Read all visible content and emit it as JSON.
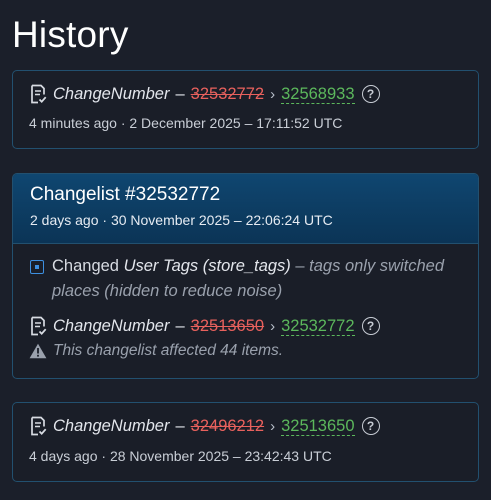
{
  "page": {
    "title": "History"
  },
  "entries": [
    {
      "label": "ChangeNumber",
      "dash": "–",
      "old_value": "32532772",
      "arrow": "›",
      "new_value": "32568933",
      "help": "?",
      "meta": "4 minutes ago · 2 December 2025 – 17:11:52 UTC"
    },
    {
      "changelist_title": "Changelist #32532772",
      "changelist_meta": "2 days ago · 30 November 2025 – 22:06:24 UTC",
      "changed_prefix": "Changed",
      "changed_field": "User Tags (store_tags)",
      "changed_dash": "–",
      "changed_note": "tags only switched places (hidden to reduce noise)",
      "label": "ChangeNumber",
      "dash": "–",
      "old_value": "32513650",
      "arrow": "›",
      "new_value": "32532772",
      "help": "?",
      "warning": "This changelist affected 44 items."
    },
    {
      "label": "ChangeNumber",
      "dash": "–",
      "old_value": "32496212",
      "arrow": "›",
      "new_value": "32513650",
      "help": "?",
      "meta": "4 days ago · 28 November 2025 – 23:42:43 UTC"
    }
  ],
  "colors": {
    "background": "#1b1f2a",
    "border": "#22506f",
    "old_value": "#e8615d",
    "new_value": "#5cb85c",
    "header": "#0f4670"
  },
  "icons": [
    "document-check-icon",
    "help-circle-icon",
    "changed-field-icon",
    "warning-icon"
  ]
}
